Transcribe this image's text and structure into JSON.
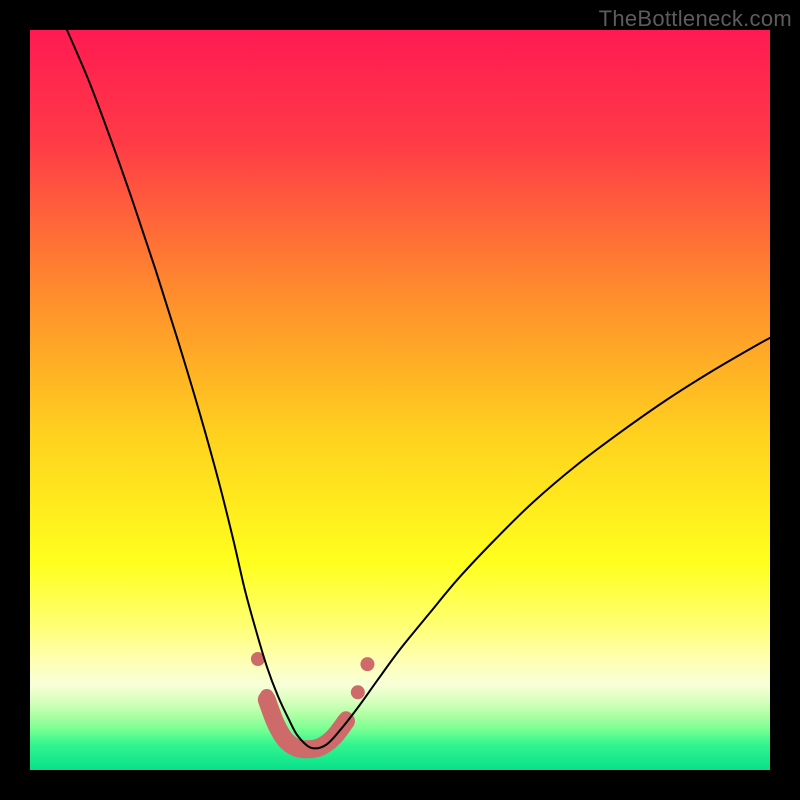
{
  "watermark": "TheBottleneck.com",
  "chart_data": {
    "type": "line",
    "title": "",
    "xlabel": "",
    "ylabel": "",
    "xlim": [
      0,
      100
    ],
    "ylim": [
      0,
      100
    ],
    "gradient_stops": [
      {
        "offset": 0.0,
        "color": "#ff1a52"
      },
      {
        "offset": 0.15,
        "color": "#ff3a47"
      },
      {
        "offset": 0.35,
        "color": "#ff8a2e"
      },
      {
        "offset": 0.55,
        "color": "#ffd21e"
      },
      {
        "offset": 0.72,
        "color": "#ffff1e"
      },
      {
        "offset": 0.8,
        "color": "#ffff6e"
      },
      {
        "offset": 0.85,
        "color": "#ffffb0"
      },
      {
        "offset": 0.885,
        "color": "#f8ffd8"
      },
      {
        "offset": 0.905,
        "color": "#daffc0"
      },
      {
        "offset": 0.925,
        "color": "#b0ffa5"
      },
      {
        "offset": 0.945,
        "color": "#78ff93"
      },
      {
        "offset": 0.965,
        "color": "#35f58f"
      },
      {
        "offset": 1.0,
        "color": "#07e08a"
      }
    ],
    "series": [
      {
        "name": "bottleneck-curve",
        "color": "#000000",
        "width": 2.0,
        "x": [
          5,
          8,
          11,
          14,
          17,
          20,
          23,
          25.5,
          27.5,
          29,
          30.5,
          32,
          33.5,
          35,
          36.2,
          38,
          40,
          42,
          44.5,
          47,
          50,
          54,
          58,
          63,
          68,
          74,
          80,
          86,
          92,
          98,
          100
        ],
        "y": [
          100,
          93,
          85,
          76.5,
          67.5,
          58,
          48,
          39,
          31,
          24.5,
          19,
          14,
          10,
          6.8,
          4.6,
          3.0,
          3.4,
          5.5,
          8.7,
          12.2,
          16.3,
          21.2,
          26.0,
          31.3,
          36.2,
          41.3,
          45.8,
          50.0,
          53.8,
          57.3,
          58.4
        ]
      }
    ],
    "markers": {
      "name": "fit-dots",
      "color": "#cf6a6a",
      "radius": 7,
      "points": [
        {
          "x": 30.8,
          "y": 15.0
        },
        {
          "x": 32.0,
          "y": 10.0
        },
        {
          "x": 33.2,
          "y": 6.5
        },
        {
          "x": 34.5,
          "y": 4.3
        },
        {
          "x": 36.0,
          "y": 3.0
        },
        {
          "x": 37.5,
          "y": 2.8
        },
        {
          "x": 39.2,
          "y": 3.2
        },
        {
          "x": 41.0,
          "y": 4.6
        },
        {
          "x": 42.7,
          "y": 7.0
        },
        {
          "x": 44.3,
          "y": 10.5
        },
        {
          "x": 45.6,
          "y": 14.3
        }
      ]
    },
    "thick_segment": {
      "name": "fit-band",
      "color": "#cf6a6a",
      "width": 18,
      "x": [
        32.0,
        33.2,
        34.5,
        36.0,
        37.5,
        39.2,
        41.0,
        42.7
      ],
      "y": [
        9.5,
        6.3,
        4.1,
        3.0,
        2.8,
        3.1,
        4.4,
        6.6
      ]
    }
  }
}
